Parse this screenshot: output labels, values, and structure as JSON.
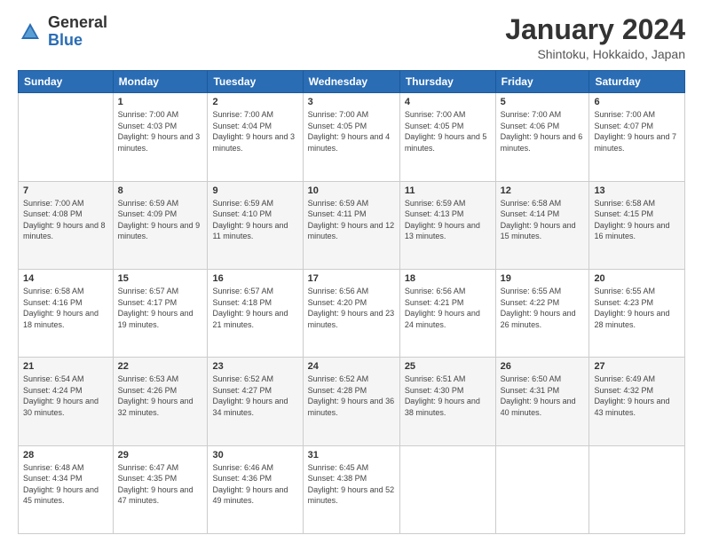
{
  "header": {
    "logo_general": "General",
    "logo_blue": "Blue",
    "month_title": "January 2024",
    "location": "Shintoku, Hokkaido, Japan"
  },
  "weekdays": [
    "Sunday",
    "Monday",
    "Tuesday",
    "Wednesday",
    "Thursday",
    "Friday",
    "Saturday"
  ],
  "weeks": [
    [
      {
        "day": "",
        "sunrise": "",
        "sunset": "",
        "daylight": ""
      },
      {
        "day": "1",
        "sunrise": "Sunrise: 7:00 AM",
        "sunset": "Sunset: 4:03 PM",
        "daylight": "Daylight: 9 hours and 3 minutes."
      },
      {
        "day": "2",
        "sunrise": "Sunrise: 7:00 AM",
        "sunset": "Sunset: 4:04 PM",
        "daylight": "Daylight: 9 hours and 3 minutes."
      },
      {
        "day": "3",
        "sunrise": "Sunrise: 7:00 AM",
        "sunset": "Sunset: 4:05 PM",
        "daylight": "Daylight: 9 hours and 4 minutes."
      },
      {
        "day": "4",
        "sunrise": "Sunrise: 7:00 AM",
        "sunset": "Sunset: 4:05 PM",
        "daylight": "Daylight: 9 hours and 5 minutes."
      },
      {
        "day": "5",
        "sunrise": "Sunrise: 7:00 AM",
        "sunset": "Sunset: 4:06 PM",
        "daylight": "Daylight: 9 hours and 6 minutes."
      },
      {
        "day": "6",
        "sunrise": "Sunrise: 7:00 AM",
        "sunset": "Sunset: 4:07 PM",
        "daylight": "Daylight: 9 hours and 7 minutes."
      }
    ],
    [
      {
        "day": "7",
        "sunrise": "Sunrise: 7:00 AM",
        "sunset": "Sunset: 4:08 PM",
        "daylight": "Daylight: 9 hours and 8 minutes."
      },
      {
        "day": "8",
        "sunrise": "Sunrise: 6:59 AM",
        "sunset": "Sunset: 4:09 PM",
        "daylight": "Daylight: 9 hours and 9 minutes."
      },
      {
        "day": "9",
        "sunrise": "Sunrise: 6:59 AM",
        "sunset": "Sunset: 4:10 PM",
        "daylight": "Daylight: 9 hours and 11 minutes."
      },
      {
        "day": "10",
        "sunrise": "Sunrise: 6:59 AM",
        "sunset": "Sunset: 4:11 PM",
        "daylight": "Daylight: 9 hours and 12 minutes."
      },
      {
        "day": "11",
        "sunrise": "Sunrise: 6:59 AM",
        "sunset": "Sunset: 4:13 PM",
        "daylight": "Daylight: 9 hours and 13 minutes."
      },
      {
        "day": "12",
        "sunrise": "Sunrise: 6:58 AM",
        "sunset": "Sunset: 4:14 PM",
        "daylight": "Daylight: 9 hours and 15 minutes."
      },
      {
        "day": "13",
        "sunrise": "Sunrise: 6:58 AM",
        "sunset": "Sunset: 4:15 PM",
        "daylight": "Daylight: 9 hours and 16 minutes."
      }
    ],
    [
      {
        "day": "14",
        "sunrise": "Sunrise: 6:58 AM",
        "sunset": "Sunset: 4:16 PM",
        "daylight": "Daylight: 9 hours and 18 minutes."
      },
      {
        "day": "15",
        "sunrise": "Sunrise: 6:57 AM",
        "sunset": "Sunset: 4:17 PM",
        "daylight": "Daylight: 9 hours and 19 minutes."
      },
      {
        "day": "16",
        "sunrise": "Sunrise: 6:57 AM",
        "sunset": "Sunset: 4:18 PM",
        "daylight": "Daylight: 9 hours and 21 minutes."
      },
      {
        "day": "17",
        "sunrise": "Sunrise: 6:56 AM",
        "sunset": "Sunset: 4:20 PM",
        "daylight": "Daylight: 9 hours and 23 minutes."
      },
      {
        "day": "18",
        "sunrise": "Sunrise: 6:56 AM",
        "sunset": "Sunset: 4:21 PM",
        "daylight": "Daylight: 9 hours and 24 minutes."
      },
      {
        "day": "19",
        "sunrise": "Sunrise: 6:55 AM",
        "sunset": "Sunset: 4:22 PM",
        "daylight": "Daylight: 9 hours and 26 minutes."
      },
      {
        "day": "20",
        "sunrise": "Sunrise: 6:55 AM",
        "sunset": "Sunset: 4:23 PM",
        "daylight": "Daylight: 9 hours and 28 minutes."
      }
    ],
    [
      {
        "day": "21",
        "sunrise": "Sunrise: 6:54 AM",
        "sunset": "Sunset: 4:24 PM",
        "daylight": "Daylight: 9 hours and 30 minutes."
      },
      {
        "day": "22",
        "sunrise": "Sunrise: 6:53 AM",
        "sunset": "Sunset: 4:26 PM",
        "daylight": "Daylight: 9 hours and 32 minutes."
      },
      {
        "day": "23",
        "sunrise": "Sunrise: 6:52 AM",
        "sunset": "Sunset: 4:27 PM",
        "daylight": "Daylight: 9 hours and 34 minutes."
      },
      {
        "day": "24",
        "sunrise": "Sunrise: 6:52 AM",
        "sunset": "Sunset: 4:28 PM",
        "daylight": "Daylight: 9 hours and 36 minutes."
      },
      {
        "day": "25",
        "sunrise": "Sunrise: 6:51 AM",
        "sunset": "Sunset: 4:30 PM",
        "daylight": "Daylight: 9 hours and 38 minutes."
      },
      {
        "day": "26",
        "sunrise": "Sunrise: 6:50 AM",
        "sunset": "Sunset: 4:31 PM",
        "daylight": "Daylight: 9 hours and 40 minutes."
      },
      {
        "day": "27",
        "sunrise": "Sunrise: 6:49 AM",
        "sunset": "Sunset: 4:32 PM",
        "daylight": "Daylight: 9 hours and 43 minutes."
      }
    ],
    [
      {
        "day": "28",
        "sunrise": "Sunrise: 6:48 AM",
        "sunset": "Sunset: 4:34 PM",
        "daylight": "Daylight: 9 hours and 45 minutes."
      },
      {
        "day": "29",
        "sunrise": "Sunrise: 6:47 AM",
        "sunset": "Sunset: 4:35 PM",
        "daylight": "Daylight: 9 hours and 47 minutes."
      },
      {
        "day": "30",
        "sunrise": "Sunrise: 6:46 AM",
        "sunset": "Sunset: 4:36 PM",
        "daylight": "Daylight: 9 hours and 49 minutes."
      },
      {
        "day": "31",
        "sunrise": "Sunrise: 6:45 AM",
        "sunset": "Sunset: 4:38 PM",
        "daylight": "Daylight: 9 hours and 52 minutes."
      },
      {
        "day": "",
        "sunrise": "",
        "sunset": "",
        "daylight": ""
      },
      {
        "day": "",
        "sunrise": "",
        "sunset": "",
        "daylight": ""
      },
      {
        "day": "",
        "sunrise": "",
        "sunset": "",
        "daylight": ""
      }
    ]
  ]
}
